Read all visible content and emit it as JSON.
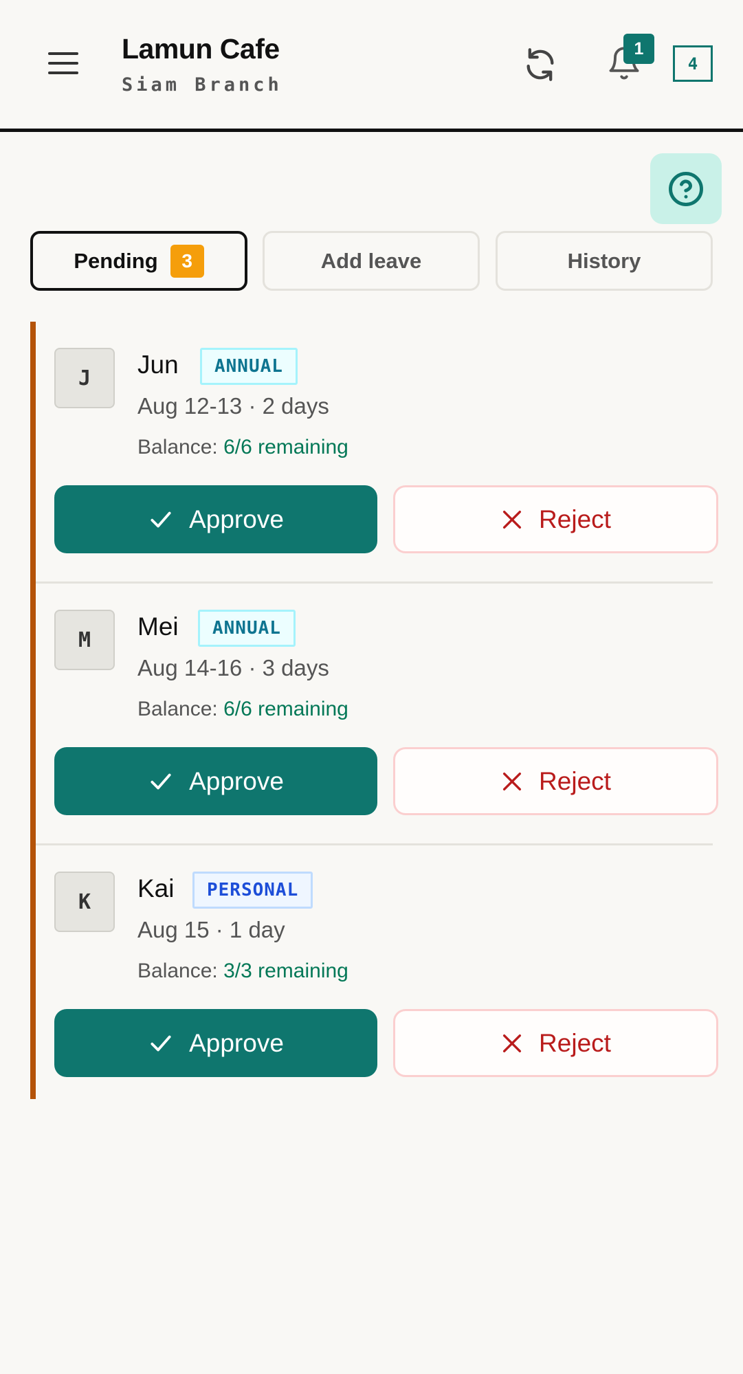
{
  "header": {
    "title": "Lamun Cafe",
    "subtitle": "Siam Branch",
    "notifications_count": "1",
    "count_box": "4"
  },
  "tabs": [
    {
      "label": "Pending",
      "badge": "3",
      "active": true
    },
    {
      "label": "Add leave"
    },
    {
      "label": "History"
    }
  ],
  "requests": [
    {
      "initial": "J",
      "name": "Jun",
      "type": "ANNUAL",
      "dates": "Aug 12-13 · 2 days",
      "balance_label": "Balance:",
      "balance_value": "6/6 remaining",
      "approve_label": "Approve",
      "reject_label": "Reject"
    },
    {
      "initial": "M",
      "name": "Mei",
      "type": "ANNUAL",
      "dates": "Aug 14-16 · 3 days",
      "balance_label": "Balance:",
      "balance_value": "6/6 remaining",
      "approve_label": "Approve",
      "reject_label": "Reject"
    },
    {
      "initial": "K",
      "name": "Kai",
      "type": "PERSONAL",
      "dates": "Aug 15 · 1 day",
      "balance_label": "Balance:",
      "balance_value": "3/3 remaining",
      "approve_label": "Approve",
      "reject_label": "Reject"
    }
  ],
  "colors": {
    "accent": "#0f766e",
    "pending_badge": "#f59e0b",
    "card_border": "#b45309",
    "reject": "#b91c1c",
    "balance_green": "#047857"
  }
}
